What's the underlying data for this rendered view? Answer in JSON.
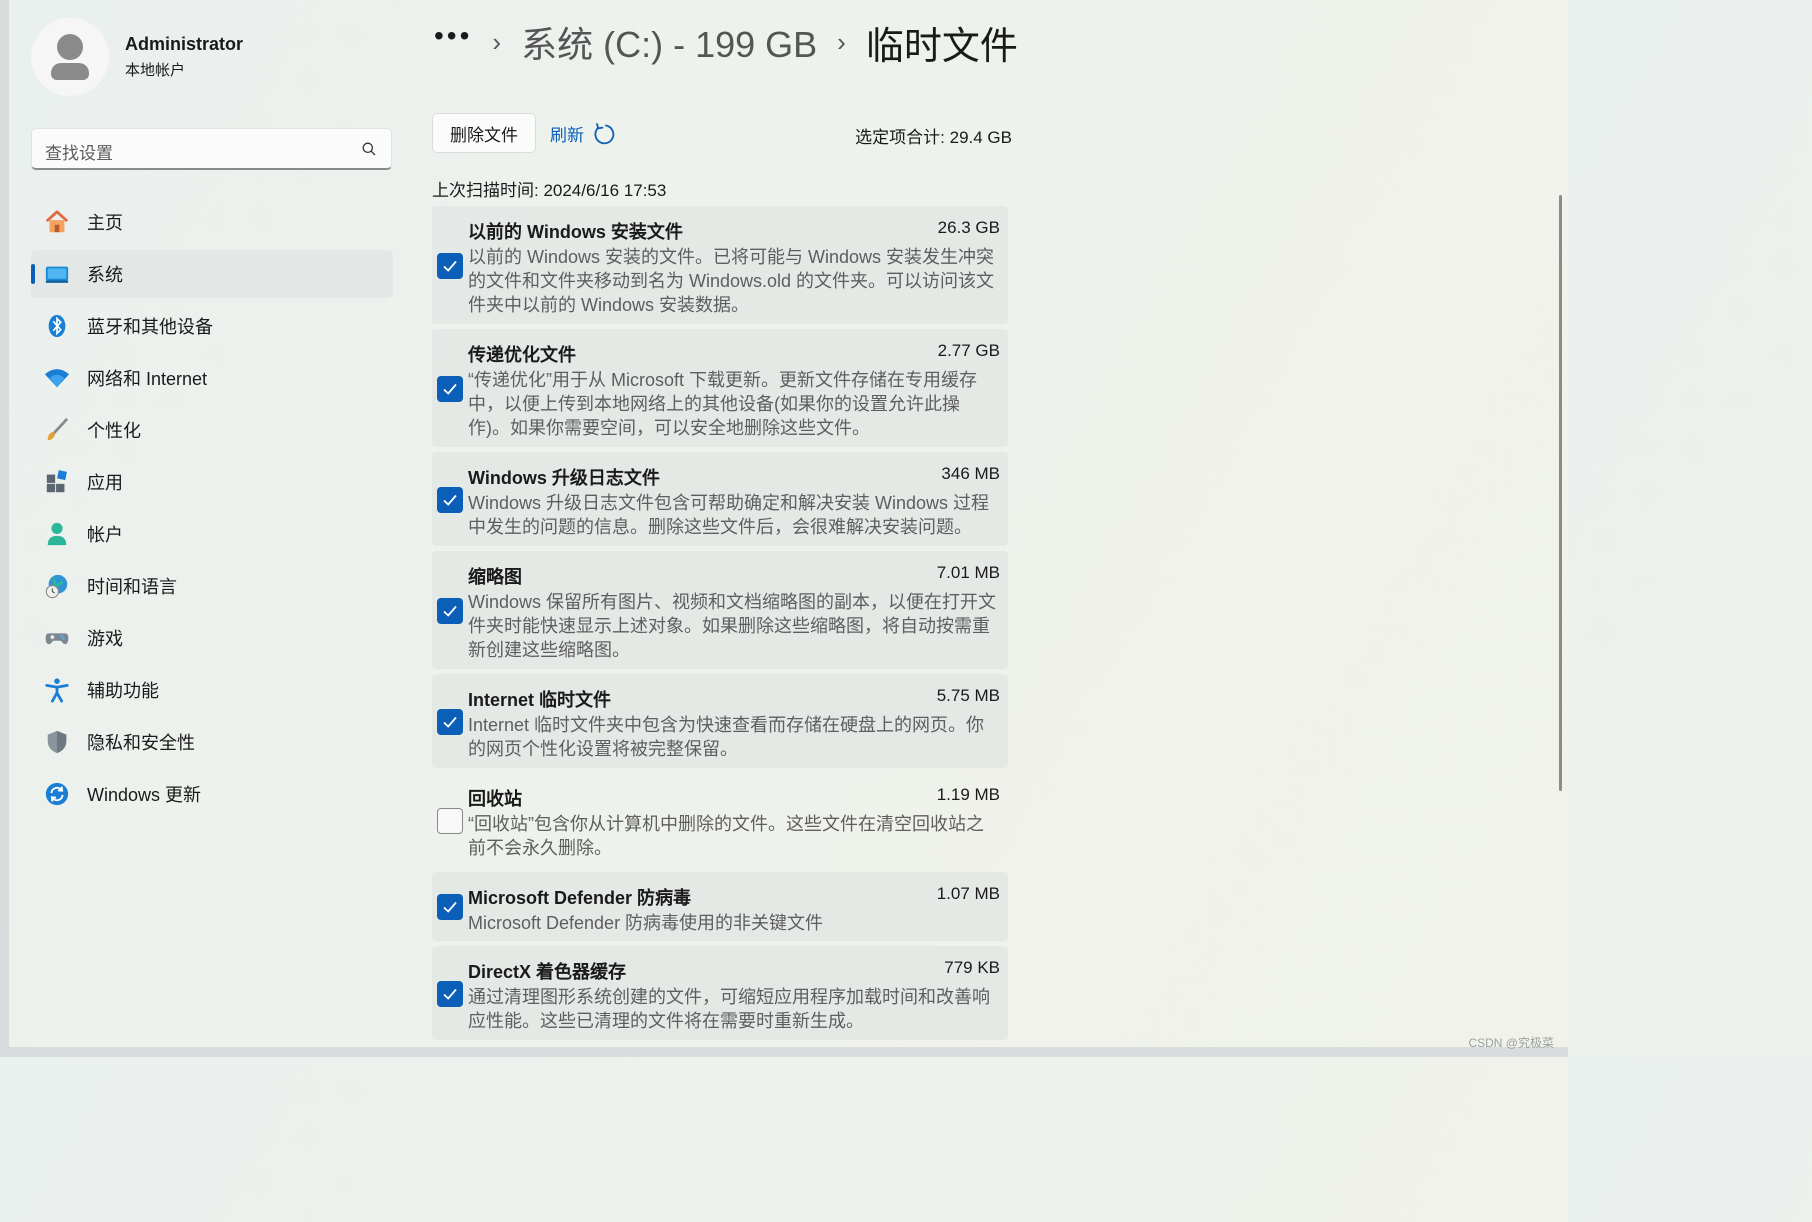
{
  "profile": {
    "name": "Administrator",
    "subtitle": "本地帐户"
  },
  "search": {
    "placeholder": "查找设置"
  },
  "nav": [
    {
      "label": "主页",
      "icon": "home-icon",
      "active": false
    },
    {
      "label": "系统",
      "icon": "system-icon",
      "active": true
    },
    {
      "label": "蓝牙和其他设备",
      "icon": "bluetooth-icon",
      "active": false
    },
    {
      "label": "网络和 Internet",
      "icon": "wifi-icon",
      "active": false
    },
    {
      "label": "个性化",
      "icon": "brush-icon",
      "active": false
    },
    {
      "label": "应用",
      "icon": "apps-icon",
      "active": false
    },
    {
      "label": "帐户",
      "icon": "account-icon",
      "active": false
    },
    {
      "label": "时间和语言",
      "icon": "globe-clock-icon",
      "active": false
    },
    {
      "label": "游戏",
      "icon": "gamepad-icon",
      "active": false
    },
    {
      "label": "辅助功能",
      "icon": "accessibility-icon",
      "active": false
    },
    {
      "label": "隐私和安全性",
      "icon": "shield-icon",
      "active": false
    },
    {
      "label": "Windows 更新",
      "icon": "update-icon",
      "active": false
    }
  ],
  "breadcrumb": {
    "dots": "•••",
    "sep": "›",
    "parent": "系统 (C:) - 199 GB",
    "current": "临时文件"
  },
  "toolbar": {
    "delete_label": "删除文件",
    "refresh_label": "刷新",
    "total": "选定项合计: 29.4 GB"
  },
  "scan_time": "上次扫描时间: 2024/6/16 17:53",
  "items": [
    {
      "title": "以前的 Windows 安装文件",
      "size": "26.3 GB",
      "checked": true,
      "desc": "以前的 Windows 安装的文件。已将可能与 Windows 安装发生冲突的文件和文件夹移动到名为 Windows.old 的文件夹。可以访问该文件夹中以前的 Windows 安装数据。"
    },
    {
      "title": "传递优化文件",
      "size": "2.77 GB",
      "checked": true,
      "desc": "“传递优化”用于从 Microsoft 下载更新。更新文件存储在专用缓存中，以便上传到本地网络上的其他设备(如果你的设置允许此操作)。如果你需要空间，可以安全地删除这些文件。"
    },
    {
      "title": "Windows 升级日志文件",
      "size": "346 MB",
      "checked": true,
      "desc": "Windows 升级日志文件包含可帮助确定和解决安装 Windows 过程中发生的问题的信息。删除这些文件后，会很难解决安装问题。"
    },
    {
      "title": "缩略图",
      "size": "7.01 MB",
      "checked": true,
      "desc": "Windows 保留所有图片、视频和文档缩略图的副本，以便在打开文件夹时能快速显示上述对象。如果删除这些缩略图，将自动按需重新创建这些缩略图。"
    },
    {
      "title": "Internet 临时文件",
      "size": "5.75 MB",
      "checked": true,
      "desc": "Internet 临时文件夹中包含为快速查看而存储在硬盘上的网页。你的网页个性化设置将被完整保留。"
    },
    {
      "title": "回收站",
      "size": "1.19 MB",
      "checked": false,
      "desc": "“回收站”包含你从计算机中删除的文件。这些文件在清空回收站之前不会永久删除。"
    },
    {
      "title": "Microsoft Defender 防病毒",
      "size": "1.07 MB",
      "checked": true,
      "desc": "Microsoft Defender 防病毒使用的非关键文件"
    },
    {
      "title": "DirectX 着色器缓存",
      "size": "779 KB",
      "checked": true,
      "desc": "通过清理图形系统创建的文件，可缩短应用程序加载时间和改善响应性能。这些已清理的文件将在需要时重新生成。"
    }
  ],
  "watermark": "CSDN @究极菜",
  "colors": {
    "accent": "#0b5fb8"
  }
}
